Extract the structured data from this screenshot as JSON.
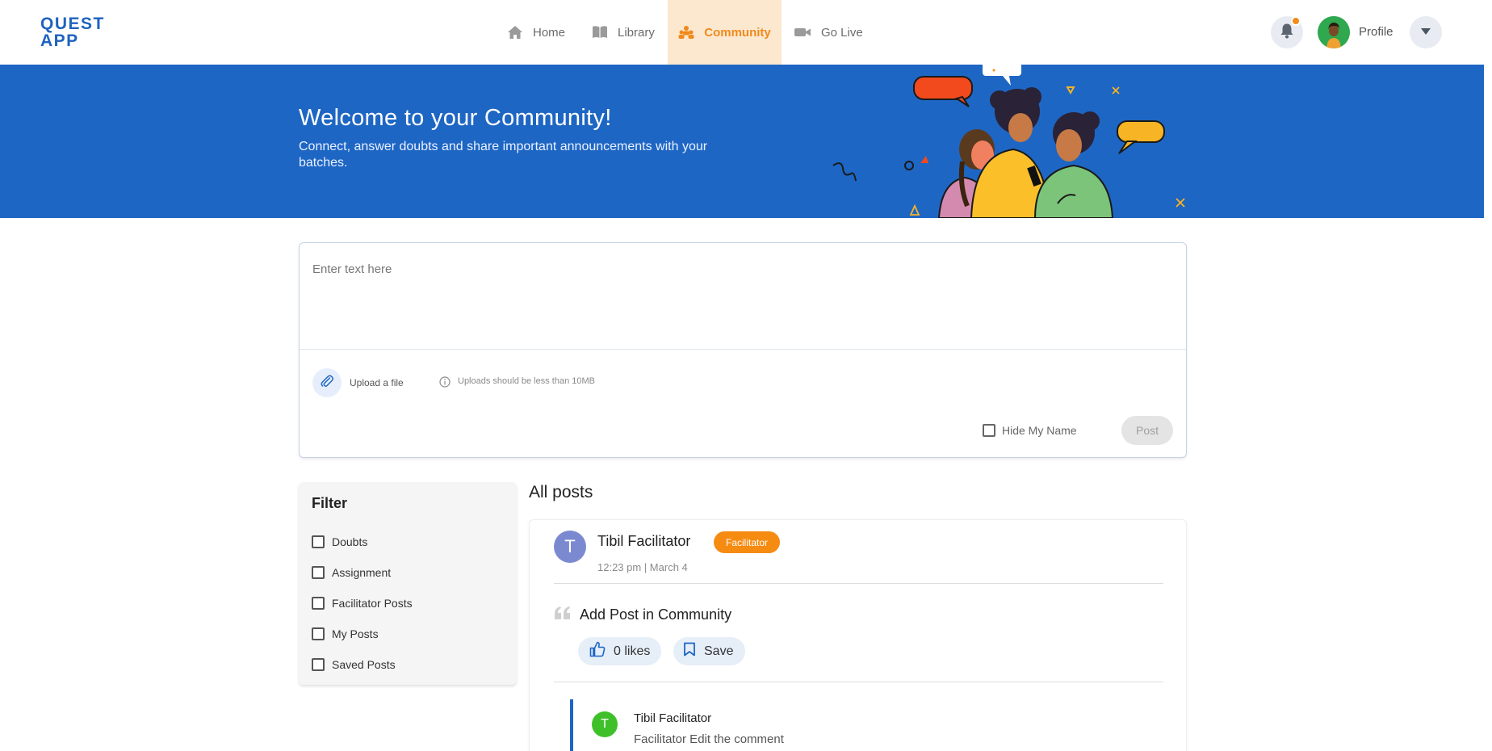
{
  "app": {
    "logo_line1": "QUEST",
    "logo_line2": "APP"
  },
  "nav": {
    "items": [
      {
        "label": "Home",
        "icon": "home-icon",
        "active": false
      },
      {
        "label": "Library",
        "icon": "book-icon",
        "active": false
      },
      {
        "label": "Community",
        "icon": "community-icon",
        "active": true
      },
      {
        "label": "Go Live",
        "icon": "video-icon",
        "active": false
      }
    ],
    "profile_label": "Profile",
    "accent_color": "#f08a1b"
  },
  "banner": {
    "title": "Welcome to your Community!",
    "subtitle": "Connect, answer doubts and share important announcements with your batches.",
    "background": "#1e66c4"
  },
  "composer": {
    "placeholder": "Enter text here",
    "upload_label": "Upload a file",
    "upload_note": "Uploads should be less than 10MB",
    "hide_name_label": "Hide My Name",
    "hide_name_checked": false,
    "post_label": "Post"
  },
  "filter": {
    "title": "Filter",
    "options": [
      {
        "label": "Doubts",
        "checked": false
      },
      {
        "label": "Assignment",
        "checked": false
      },
      {
        "label": "Facilitator Posts",
        "checked": false
      },
      {
        "label": "My Posts",
        "checked": false
      },
      {
        "label": "Saved Posts",
        "checked": false
      }
    ]
  },
  "posts": {
    "title": "All posts",
    "items": [
      {
        "avatar_letter": "T",
        "author": "Tibil Facilitator",
        "role_badge": "Facilitator",
        "time": "12:23 pm | March 4",
        "text": "Add Post in Community",
        "likes_label": "0 likes",
        "save_label": "Save",
        "comments": [
          {
            "avatar_letter": "T",
            "author": "Tibil Facilitator",
            "text": "Facilitator Edit the comment"
          }
        ]
      }
    ]
  }
}
